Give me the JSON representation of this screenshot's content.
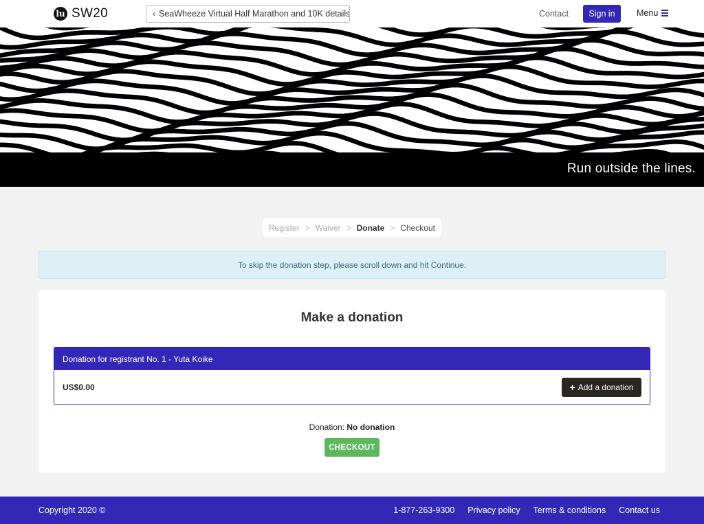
{
  "header": {
    "logo_mark": "lu",
    "logo_text": "SW20",
    "back_label": "SeaWheeze Virtual Half Marathon and 10K details",
    "contact_label": "Contact",
    "signin_label": "Sign in",
    "menu_label": "Menu"
  },
  "hero": {
    "tagline": "Run outside the lines."
  },
  "steps": [
    {
      "label": "Register",
      "state": "done"
    },
    {
      "label": "Waiver",
      "state": "done"
    },
    {
      "label": "Donate",
      "state": "active"
    },
    {
      "label": "Checkout",
      "state": "next"
    }
  ],
  "steps_separator": ">",
  "notice": "To skip the donation step, please scroll down and hit Continue.",
  "donation_card": {
    "title": "Make a donation",
    "registrant_header": "Donation for registrant No. 1 - Yuta Koike",
    "amount": "US$0.00",
    "add_button_label": "Add a donation",
    "donation_label": "Donation:",
    "donation_value": "No donation",
    "checkout_label": "CHECKOUT"
  },
  "footer": {
    "copyright": "Copyright 2020 ©",
    "phone": "1-877-263-9300",
    "privacy": "Privacy policy",
    "terms": "Terms & conditions",
    "contact": "Contact us"
  },
  "colors": {
    "brand": "#3327b8",
    "checkout": "#5cb85c",
    "notice_bg": "#dcf0f6",
    "add_button": "#2b2622"
  }
}
